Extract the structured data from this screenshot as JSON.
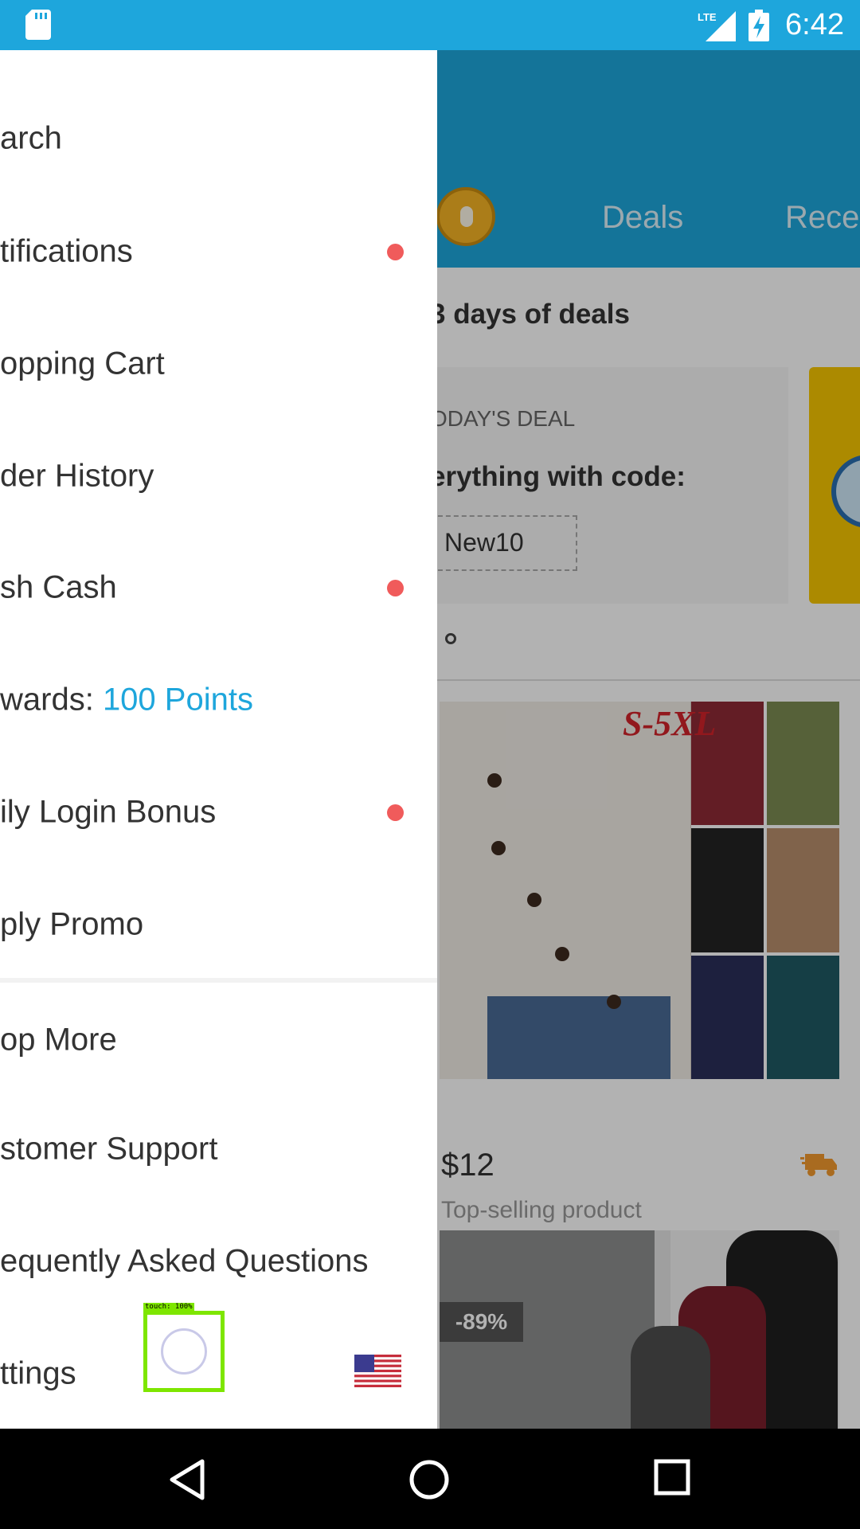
{
  "status_bar": {
    "time": "6:42",
    "network": "LTE",
    "icons": [
      "sd-card-icon",
      "lte-signal-icon",
      "battery-charging-icon"
    ]
  },
  "background": {
    "tabs": [
      "Deals",
      "Rece"
    ],
    "heading": "3 days of deals",
    "deal_label": "ODAY'S DEAL",
    "deal_text": "erything with code:",
    "promo_code": "New10",
    "product1": {
      "banner": "S-5XL",
      "price": "$12",
      "subtitle": "Top-selling product"
    },
    "product2": {
      "discount": "-89%"
    }
  },
  "drawer": {
    "items": [
      {
        "label": "arch",
        "dot": false
      },
      {
        "label": "tifications",
        "dot": true
      },
      {
        "label": "opping Cart",
        "dot": false
      },
      {
        "label": "der History",
        "dot": false
      },
      {
        "label": "sh Cash",
        "dot": true
      },
      {
        "label": "wards: ",
        "accent": "100 Points",
        "dot": false
      },
      {
        "label": "ily Login Bonus",
        "dot": true
      },
      {
        "label": "ply Promo",
        "dot": false
      },
      {
        "label": "op More",
        "dot": false
      },
      {
        "label": "stomer Support",
        "dot": false
      },
      {
        "label": "equently Asked Questions",
        "dot": false
      },
      {
        "label": "ttings",
        "dot": false
      }
    ],
    "flag": "us-flag-icon"
  },
  "touch": {
    "label": "touch: 100%"
  },
  "nav_bar": {
    "icons": [
      "back-icon",
      "home-icon",
      "recents-icon"
    ]
  },
  "colors": {
    "accent": "#1ea6dc",
    "notification_dot": "#f05b5b",
    "touch_box": "#7ee600"
  }
}
